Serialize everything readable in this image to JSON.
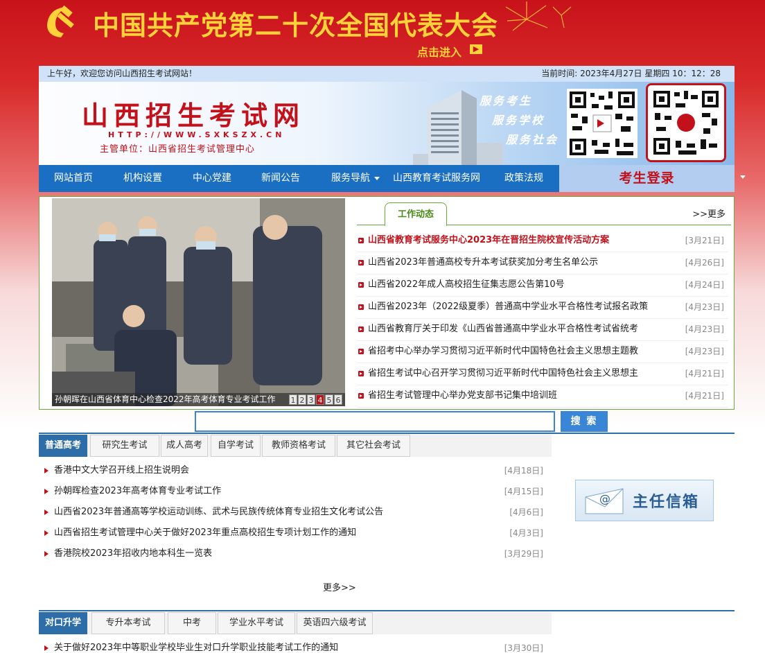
{
  "banner": {
    "title": "中国共产党第二十次全国代表大会",
    "enter": "点击进入"
  },
  "topbar": {
    "welcome": "上午好，欢迎您访问山西招生考试网站！",
    "time": "当前时间:  2023年4月27日 星期四 10：12：28"
  },
  "header": {
    "site_name": "山西招生考试网",
    "url": "HTTP://WWW.SXKSZX.CN",
    "sponsor": "主管单位：山西省招生考试管理中心",
    "slogans": [
      "服务考生",
      "服务学校",
      "服务社会"
    ]
  },
  "nav": {
    "items": [
      "网站首页",
      "机构设置",
      "中心党建",
      "新闻公告",
      "服务导航",
      "山西教育考试服务网",
      "政策法规"
    ],
    "login": "考生登录"
  },
  "slideshow": {
    "caption": "孙朝晖在山西省体育中心检查2022年高考体育专业考试工作",
    "pages": [
      "1",
      "2",
      "3",
      "4",
      "5",
      "6"
    ],
    "active_page": "4"
  },
  "work_news": {
    "tab": "工作动态",
    "more": ">>更多",
    "items": [
      {
        "title": "山西省教育考试服务中心2023年在晋招生院校宣传活动方案",
        "date": "[3月21日]"
      },
      {
        "title": "山西省2023年普通高校专升本考试获奖加分考生名单公示",
        "date": "[4月26日]"
      },
      {
        "title": "山西省2022年成人高校招生征集志愿公告第10号",
        "date": "[4月24日]"
      },
      {
        "title": "山西省2023年（2022级夏季）普通高中学业水平合格性考试报名政策",
        "date": "[4月23日]"
      },
      {
        "title": "山西省教育厅关于印发《山西省普通高中学业水平合格性考试省统考",
        "date": "[4月23日]"
      },
      {
        "title": "省招考中心举办学习贯彻习近平新时代中国特色社会主义思想主题教",
        "date": "[4月23日]"
      },
      {
        "title": "省招生考试中心召开学习贯彻习近平新时代中国特色社会主义思想主",
        "date": "[4月21日]"
      },
      {
        "title": "省招生考试管理中心举办党支部书记集中培训班",
        "date": "[4月21日]"
      }
    ]
  },
  "search": {
    "value": "",
    "button": "搜 索"
  },
  "section1": {
    "tabs": [
      "普通高考",
      "研究生考试",
      "成人高考",
      "自学考试",
      "教师资格考试",
      "其它社会考试"
    ],
    "items": [
      {
        "title": "香港中文大学召开线上招生说明会",
        "date": "[4月18日]"
      },
      {
        "title": "孙朝晖检查2023年高考体育专业考试工作",
        "date": "[4月15日]"
      },
      {
        "title": "山西省2023年普通高等学校运动训练、武术与民族传统体育专业招生文化考试公告",
        "date": "[4月6日]"
      },
      {
        "title": "山西省招生考试管理中心关于做好2023年重点高校招生专项计划工作的通知",
        "date": "[4月3日]"
      },
      {
        "title": "香港院校2023年招收内地本科生一览表",
        "date": "[3月29日]"
      }
    ],
    "more": "更多>>"
  },
  "mailbox": {
    "label": "主任信箱"
  },
  "section2": {
    "tabs": [
      "对口升学",
      "专升本考试",
      "中考",
      "学业水平考试",
      "英语四六级考试"
    ],
    "items": [
      {
        "title": "关于做好2023年中等职业学校毕业生对口升学职业技能考试工作的通知",
        "date": "[3月30日]"
      }
    ]
  },
  "colors": {
    "brand_red": "#c2111a",
    "nav_blue": "#1b6fc2",
    "accent_green": "#6aa840",
    "gold": "#ffd23a"
  }
}
